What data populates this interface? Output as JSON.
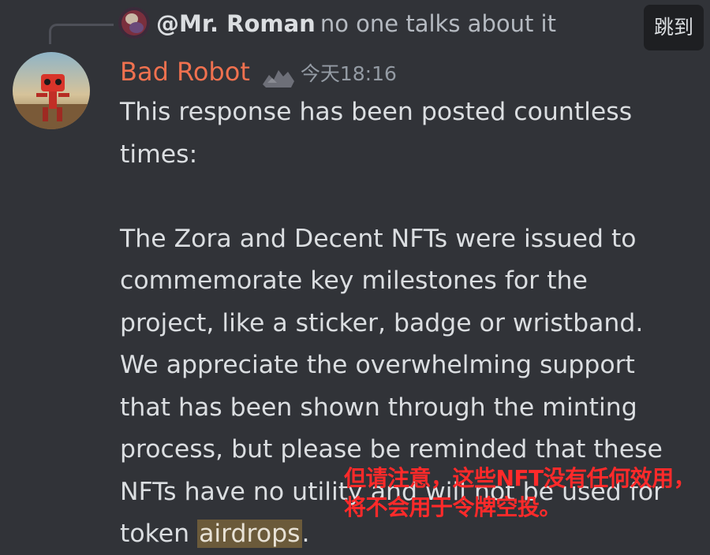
{
  "reply": {
    "author": "@Mr. Roman",
    "text": "no one talks about it"
  },
  "jump_button": {
    "label": "跳到"
  },
  "message": {
    "author": "Bad Robot",
    "timestamp": "今天18:16",
    "body_line1": "This response has been posted countless times:",
    "body_line2_before": "The Zora and Decent NFTs were issued to commemorate key milestones for the project, like a sticker, badge or wristband. We appreciate the overwhelming support that has been shown through the minting process, but please be reminded that these NFTs have no utility and will not be used for token",
    "highlight_word": "airdrops",
    "body_line2_after": "."
  },
  "overlay_note": {
    "text": "但请注意，这些NFT没有任何效用，将不会用于令牌空投。"
  },
  "colors": {
    "background": "#313338",
    "author_color": "#f0714f",
    "highlight_bg": "#6b5a3a",
    "overlay_text": "#ff2a2a"
  }
}
